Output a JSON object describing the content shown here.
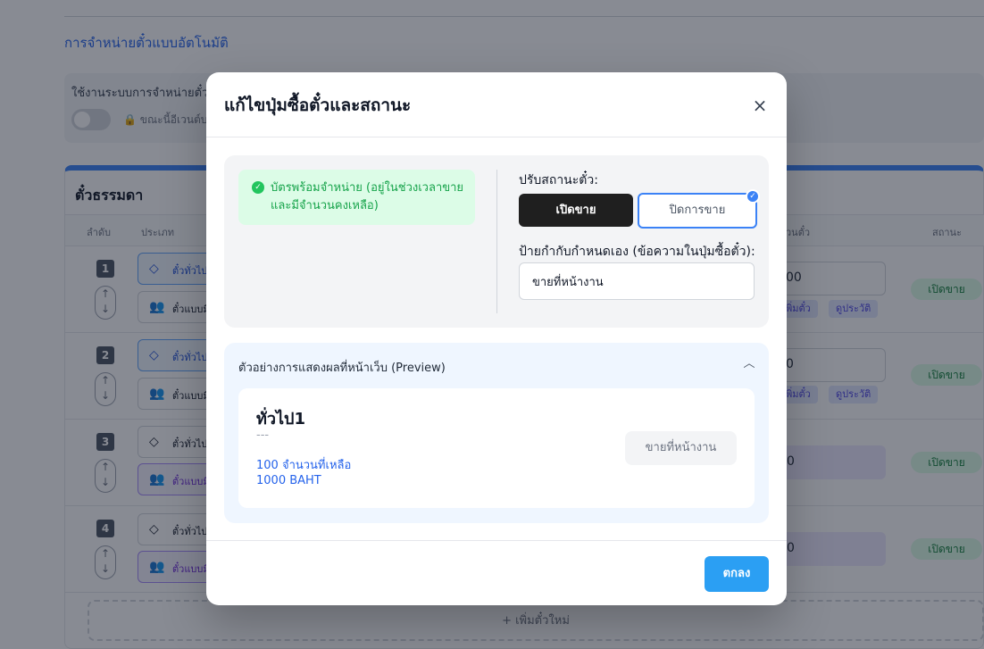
{
  "background": {
    "section_title": "การจำหน่ายตั๋วแบบอัตโนมัติ",
    "auto_label": "ใช้งานระบบการจำหน่ายตั๋ว",
    "lock_text": "ขณะนี้อีเวนต์บ",
    "card_title": "ตั๋วธรรมดา",
    "headers": {
      "order": "ลำดับ",
      "type": "ประเภท",
      "qty": "วนตั๋ว",
      "status": "สถานะ"
    },
    "rows": [
      {
        "order": "1",
        "type1": "ตั๋วทั่วไป",
        "type2": "ตั๋วแบบมี",
        "qty": "00",
        "mini1": "พิ่มตั๋ว",
        "mini2": "ดูประวัติ",
        "status": "เปิดขาย"
      },
      {
        "order": "2",
        "type1": "ตั๋วทั่วไป",
        "type2": "ตั๋วแบบมี",
        "qty": "0",
        "mini1": "พิ่มตั๋ว",
        "mini2": "ดูประวัติ",
        "status": "เปิดขาย"
      },
      {
        "order": "3",
        "type1": "ตั๋วทั่วไป",
        "type2": "ตั๋วแบบมี",
        "qty": "0",
        "status": "เปิดขาย"
      },
      {
        "order": "4",
        "type1": "ตั๋วทั่วไป",
        "type2": "ตั๋วแบบมี",
        "qty": "0",
        "status": "เปิดขาย"
      }
    ],
    "add_ticket": "+ เพิ่มตั๋วใหม่"
  },
  "modal": {
    "title": "แก้ไขปุ่มซื้อตั๋วและสถานะ",
    "close_glyph": "×",
    "availability": {
      "icon": "check-circle-icon",
      "text": "บัตรพร้อมจำหน่าย (อยู่ในช่วงเวลาขายและมีจำนวนคงเหลือ)"
    },
    "adjust_label": "ปรับสถานะตั๋ว:",
    "open_button": "เปิดขาย",
    "close_button": "ปิดการขาย",
    "selected": "close_button",
    "custom_label_title": "ป้ายกำกับกำหนดเอง (ข้อความในปุ่มซื้อตั๋ว):",
    "custom_label_value": "ขายที่หน้างาน",
    "preview": {
      "title": "ตัวอย่างการแสดงผลที่หน้าเว็บ (Preview)",
      "ticket_name": "ทั่วไป1",
      "description": "---",
      "remaining": "100 จำนวนที่เหลือ",
      "price": "1000 BAHT",
      "button_label": "ขายที่หน้างาน"
    },
    "ok_button": "ตกลง"
  },
  "colors": {
    "accent": "#3b82f6",
    "ok_button": "#2b9ff3",
    "available_bg": "#dcfce7",
    "available_text": "#16a34a",
    "open_button_bg": "#1f1f1f"
  }
}
